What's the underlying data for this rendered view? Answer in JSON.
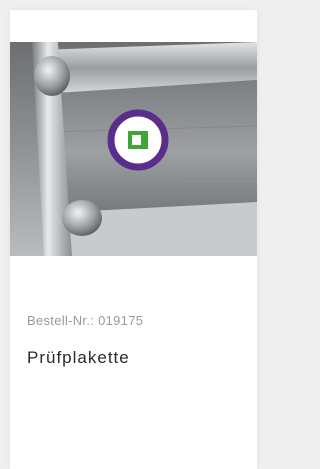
{
  "product": {
    "order_label": "Bestell-Nr.:",
    "order_number": "019175",
    "name": "Prüfplakette",
    "image_alt": "Prüfplakette"
  },
  "colors": {
    "page_background": "#efefef",
    "card_background": "#ffffff",
    "order_text": "#9a9a9a",
    "name_text": "#2a2a2a",
    "badge_ring": "#5b2d8a",
    "badge_center": "#3fa535"
  }
}
